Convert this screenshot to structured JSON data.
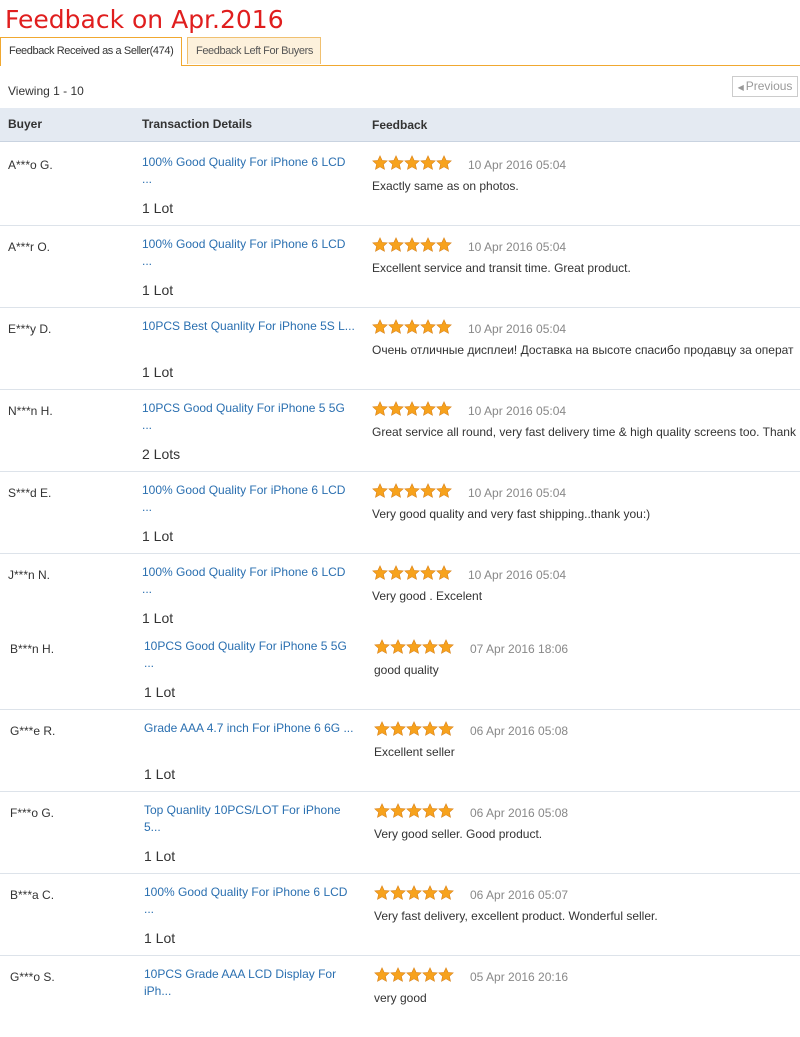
{
  "page_title": "Feedback on Apr.2016",
  "tabs": [
    {
      "label": "Feedback Received as a Seller(474)"
    },
    {
      "label": "Feedback Left For Buyers"
    }
  ],
  "viewing": "Viewing 1 - 10",
  "pagination": {
    "previous_label": "Previous"
  },
  "columns": {
    "buyer": "Buyer",
    "transaction": "Transaction Details",
    "feedback": "Feedback"
  },
  "colors": {
    "title": "#e01e1e",
    "link": "#2a6fb0",
    "star": "#f7a21c",
    "tab_border": "#f0a830"
  },
  "rows": [
    {
      "buyer": "A***o G.",
      "product": "100% Good Quality For iPhone 6 LCD ...",
      "qty": "1 Lot",
      "rating": 5,
      "date": "10 Apr 2016 05:04",
      "comment": "Exactly same as on photos."
    },
    {
      "buyer": "A***r O.",
      "product": "100% Good Quality For iPhone 6 LCD ...",
      "qty": "1 Lot",
      "rating": 5,
      "date": "10 Apr 2016 05:04",
      "comment": "Excellent service and transit time. Great product."
    },
    {
      "buyer": "E***y D.",
      "product": "10PCS Best Quanlity For iPhone 5S L...",
      "qty": "1 Lot",
      "rating": 5,
      "date": "10 Apr 2016 05:04",
      "comment": "Очень отличные дисплеи! Доставка на высоте спасибо продавцу за операт"
    },
    {
      "buyer": "N***n H.",
      "product": "10PCS Good Quality For iPhone 5 5G ...",
      "qty": "2 Lots",
      "rating": 5,
      "date": "10 Apr 2016 05:04",
      "comment": "Great service all round, very fast delivery time & high quality screens too. Thank"
    },
    {
      "buyer": "S***d E.",
      "product": "100% Good Quality For iPhone 6 LCD ...",
      "qty": "1 Lot",
      "rating": 5,
      "date": "10 Apr 2016 05:04",
      "comment": "Very good quality and very fast shipping..thank you:)"
    },
    {
      "buyer": "J***n N.",
      "product": "100% Good Quality For iPhone 6 LCD ...",
      "qty": "1 Lot",
      "rating": 5,
      "date": "10 Apr 2016 05:04",
      "comment": "Very good . Excelent"
    },
    {
      "buyer": "B***n H.",
      "product": "10PCS Good Quality For iPhone 5 5G ...",
      "qty": "1 Lot",
      "rating": 5,
      "date": "07 Apr 2016 18:06",
      "comment": "good quality"
    },
    {
      "buyer": "G***e R.",
      "product": "Grade AAA 4.7 inch For iPhone 6 6G ...",
      "qty": "1 Lot",
      "rating": 5,
      "date": "06 Apr 2016 05:08",
      "comment": "Excellent seller"
    },
    {
      "buyer": "F***o G.",
      "product": "Top Quanlity 10PCS/LOT For iPhone 5...",
      "qty": "1 Lot",
      "rating": 5,
      "date": "06 Apr 2016 05:08",
      "comment": "Very good seller. Good product."
    },
    {
      "buyer": "B***a C.",
      "product": "100% Good Quality For iPhone 6 LCD ...",
      "qty": "1 Lot",
      "rating": 5,
      "date": "06 Apr 2016 05:07",
      "comment": "Very fast delivery, excellent product. Wonderful seller."
    },
    {
      "buyer": "G***o S.",
      "product": "10PCS Grade AAA LCD Display For iPh...",
      "qty": "",
      "rating": 5,
      "date": "05 Apr 2016 20:16",
      "comment": "very good"
    }
  ]
}
